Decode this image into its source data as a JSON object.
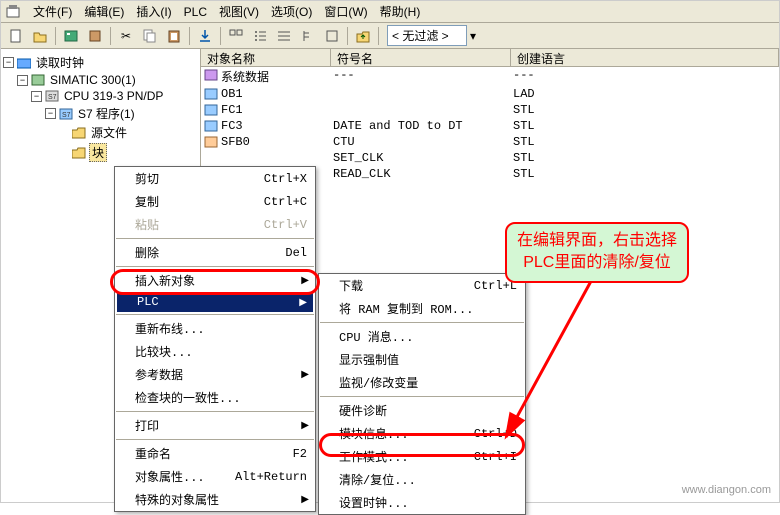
{
  "menubar": {
    "items": [
      {
        "label": "文件(F)"
      },
      {
        "label": "编辑(E)"
      },
      {
        "label": "插入(I)"
      },
      {
        "label": "PLC"
      },
      {
        "label": "视图(V)"
      },
      {
        "label": "选项(O)"
      },
      {
        "label": "窗口(W)"
      },
      {
        "label": "帮助(H)"
      }
    ]
  },
  "toolbar": {
    "filter_text": "< 无过滤 >"
  },
  "tree": {
    "root": "读取时钟",
    "station": "SIMATIC 300(1)",
    "cpu": "CPU 319-3 PN/DP",
    "program": "S7 程序(1)",
    "sources": "源文件",
    "blocks": "块"
  },
  "listview": {
    "headers": {
      "name": "对象名称",
      "sym": "符号名",
      "lang": "创建语言"
    },
    "rows": [
      {
        "icon": "db",
        "name": "系统数据",
        "sym": "---",
        "lang": "---"
      },
      {
        "icon": "ob",
        "name": "OB1",
        "sym": "",
        "lang": "LAD"
      },
      {
        "icon": "fc",
        "name": "FC1",
        "sym": "",
        "lang": "STL"
      },
      {
        "icon": "fc",
        "name": "FC3",
        "sym": "DATE and TOD to DT",
        "lang": "STL"
      },
      {
        "icon": "sfb",
        "name": "SFB0",
        "sym": "CTU",
        "lang": "STL"
      },
      {
        "icon": "",
        "name": "",
        "sym": "SET_CLK",
        "lang": "STL"
      },
      {
        "icon": "",
        "name": "",
        "sym": "READ_CLK",
        "lang": "STL"
      }
    ]
  },
  "ctx1": {
    "items": [
      {
        "label": "剪切",
        "shortcut": "Ctrl+X",
        "sep": false
      },
      {
        "label": "复制",
        "shortcut": "Ctrl+C",
        "sep": false
      },
      {
        "label": "粘贴",
        "shortcut": "Ctrl+V",
        "disabled": true,
        "sep": true
      },
      {
        "label": "删除",
        "shortcut": "Del",
        "sep": true
      },
      {
        "label": "插入新对象",
        "arrow": true,
        "sep": false
      },
      {
        "label": "PLC",
        "arrow": true,
        "highlighted": true,
        "sep": true
      },
      {
        "label": "重新布线...",
        "sep": false
      },
      {
        "label": "比较块...",
        "sep": false
      },
      {
        "label": "参考数据",
        "arrow": true,
        "sep": false
      },
      {
        "label": "检查块的一致性...",
        "sep": true
      },
      {
        "label": "打印",
        "arrow": true,
        "sep": true
      },
      {
        "label": "重命名",
        "shortcut": "F2",
        "sep": false
      },
      {
        "label": "对象属性...",
        "shortcut": "Alt+Return",
        "sep": false
      },
      {
        "label": "特殊的对象属性",
        "arrow": true,
        "sep": false
      }
    ]
  },
  "ctx2": {
    "items": [
      {
        "label": "下载",
        "shortcut": "Ctrl+L",
        "sep": false
      },
      {
        "label": "将 RAM 复制到 ROM...",
        "sep": true
      },
      {
        "label": "CPU 消息...",
        "sep": false
      },
      {
        "label": "显示强制值",
        "sep": false
      },
      {
        "label": "监视/修改变量",
        "sep": true
      },
      {
        "label": "硬件诊断",
        "sep": false
      },
      {
        "label": "模块信息...",
        "shortcut": "Ctrl+D",
        "sep": false
      },
      {
        "label": "工作模式...",
        "shortcut": "Ctrl+I",
        "sep": false
      },
      {
        "label": "清除/复位...",
        "highlighted2": true,
        "sep": false
      },
      {
        "label": "设置时钟...",
        "sep": false
      }
    ]
  },
  "callout": {
    "line1": "在编辑界面，右击选择",
    "line2": "PLC里面的清除/复位"
  },
  "watermark": "www.diangon.com"
}
